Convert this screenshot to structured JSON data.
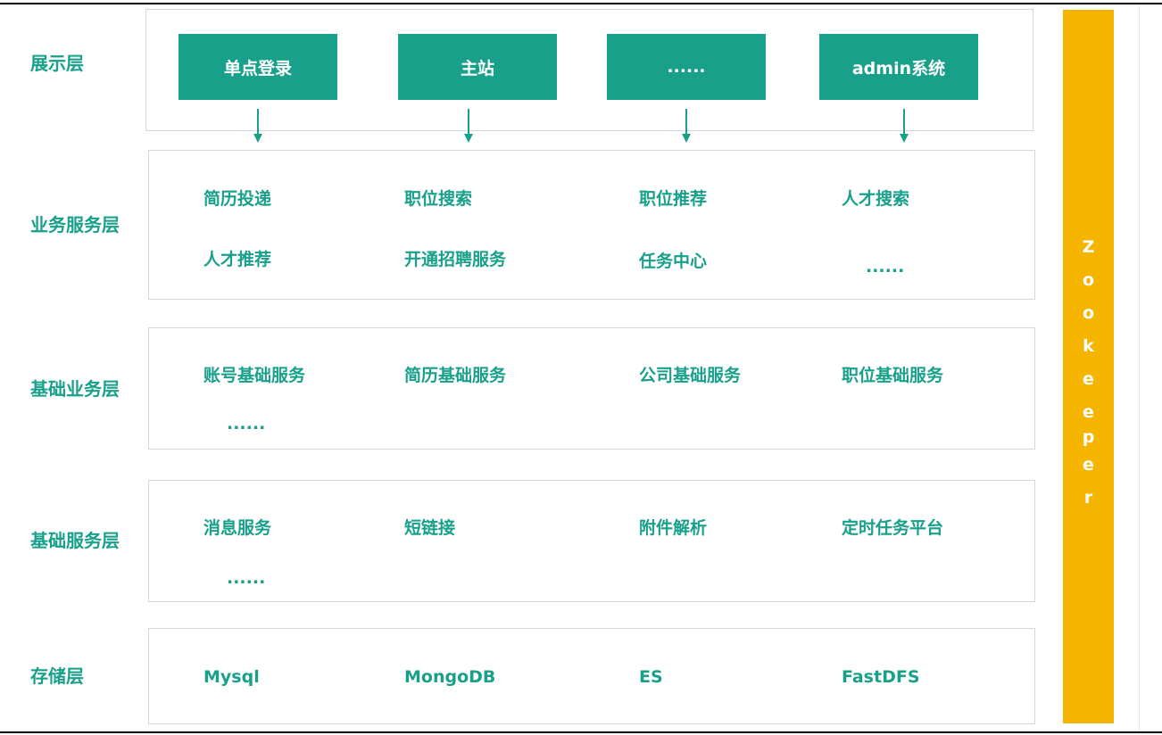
{
  "layers": {
    "presentation": {
      "label": "展示层",
      "boxes": [
        "单点登录",
        "主站",
        "......",
        "admin系统"
      ]
    },
    "business_service": {
      "label": "业务服务层",
      "row1": [
        "简历投递",
        "职位搜索",
        "职位推荐",
        "人才搜索"
      ],
      "row2": [
        "人才推荐",
        "开通招聘服务",
        "任务中心",
        "......"
      ]
    },
    "basic_business": {
      "label": "基础业务层",
      "row1": [
        "账号基础服务",
        "简历基础服务",
        "公司基础服务",
        "职位基础服务"
      ],
      "row2": [
        "......"
      ]
    },
    "basic_service": {
      "label": "基础服务层",
      "row1": [
        "消息服务",
        "短链接",
        "附件解析",
        "定时任务平台"
      ],
      "row2": [
        "......"
      ]
    },
    "storage": {
      "label": "存储层",
      "items": [
        "Mysql",
        "MongoDB",
        "ES",
        "FastDFS"
      ]
    }
  },
  "zookeeper": {
    "letters": [
      "Z",
      "o",
      "o",
      "k",
      "e",
      "e",
      "p",
      "e",
      "r"
    ]
  },
  "colors": {
    "accent": "#18a08a",
    "zookeeper": "#f5b400",
    "panel_border": "#d4d8dc"
  }
}
